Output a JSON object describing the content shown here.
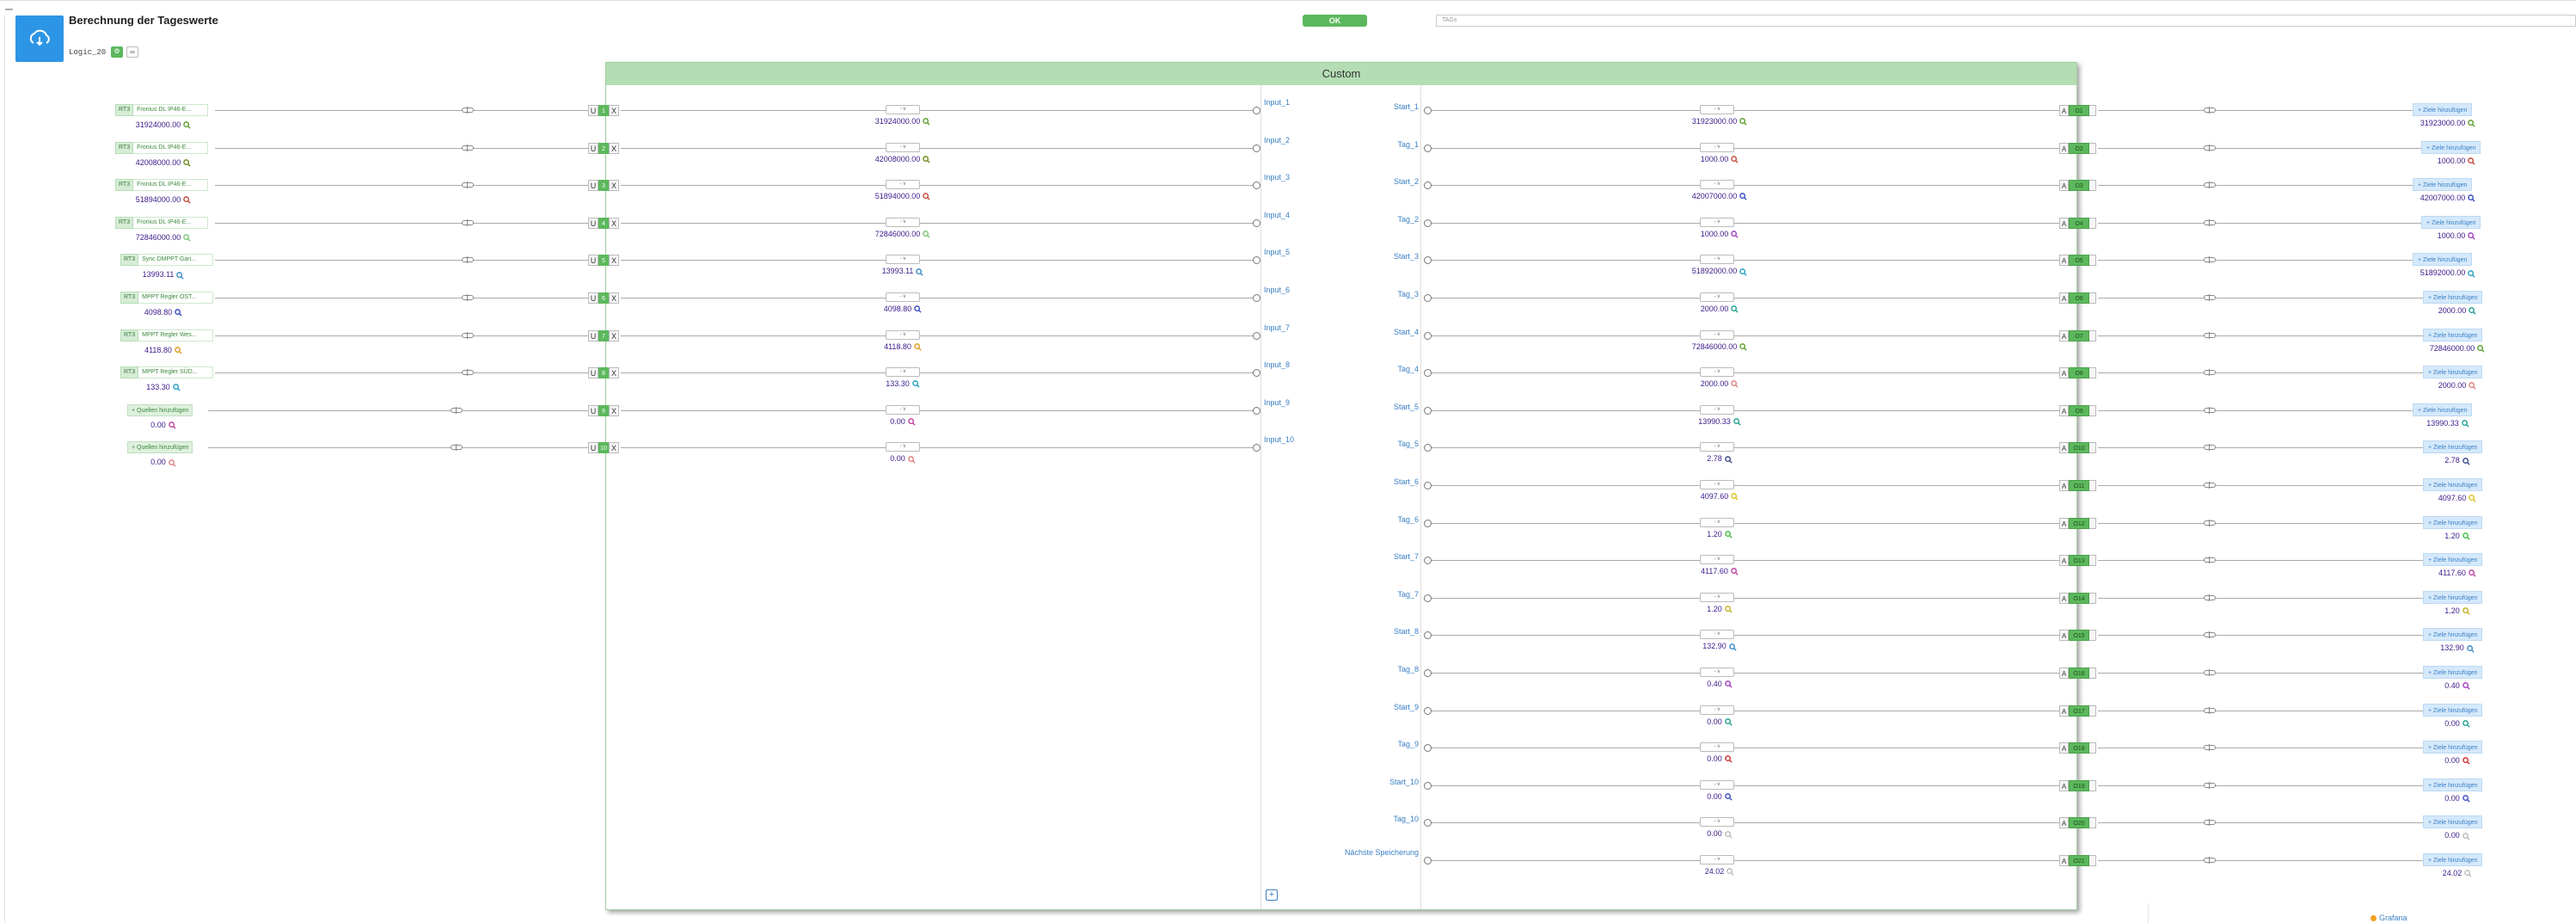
{
  "header": {
    "collapse_symbol": "–",
    "title": "Berechnung der Tageswerte",
    "logic_id": "Logic_20",
    "ok_label": "OK",
    "tags_placeholder": "TAGs",
    "app_icon": "cloud-sync-icon"
  },
  "panel": {
    "title": "Custom"
  },
  "inputs": [
    {
      "badge": "RT3",
      "source": "Fronius DL IP46-E...",
      "value": "31924000.00",
      "uix": "1",
      "label": "Input_1",
      "icon_color": "#5aa02c"
    },
    {
      "badge": "RT3",
      "source": "Fronius DL IP46-E...",
      "value": "42008000.00",
      "uix": "2",
      "label": "Input_2",
      "icon_color": "#6c8c1c"
    },
    {
      "badge": "RT3",
      "source": "Fronius DL IP46-E...",
      "value": "51894000.00",
      "uix": "3",
      "label": "Input_3",
      "icon_color": "#c04a3a"
    },
    {
      "badge": "RT3",
      "source": "Fronius DL IP46-E...",
      "value": "72846000.00",
      "uix": "4",
      "label": "Input_4",
      "icon_color": "#7ac47a"
    },
    {
      "badge": "RT3",
      "source": "Sync DMPPT Gari...",
      "value": "13993.11",
      "uix": "5",
      "label": "Input_5",
      "icon_color": "#3a8ac4"
    },
    {
      "badge": "RT3",
      "source": "MPPT Regler OST...",
      "value": "4098.80",
      "uix": "6",
      "label": "Input_6",
      "icon_color": "#3a4ac4"
    },
    {
      "badge": "RT3",
      "source": "MPPT Regler Wes...",
      "value": "4118.80",
      "uix": "7",
      "label": "Input_7",
      "icon_color": "#e09a20"
    },
    {
      "badge": "RT3",
      "source": "MPPT Regler SÜD...",
      "value": "133.30",
      "uix": "8",
      "label": "Input_8",
      "icon_color": "#20a0c0"
    },
    {
      "badge": "",
      "source": "+ Quellen hinzufügen",
      "value": "0.00",
      "uix": "9",
      "label": "Input_9",
      "icon_color": "#c040a0"
    },
    {
      "badge": "",
      "source": "+ Quellen hinzufügen",
      "value": "0.00",
      "uix": "10",
      "label": "Input_10",
      "icon_color": "#e08080"
    }
  ],
  "uix_letters": {
    "u": "U",
    "x": "X",
    "a": "A"
  },
  "dropdown_text": "- v",
  "outputs": [
    {
      "label": "Start_1",
      "value": "31923000.00",
      "out": "O1",
      "dest_value": "31923000.00",
      "icon_color": "#5aa02c"
    },
    {
      "label": "Tag_1",
      "value": "1000.00",
      "out": "O2",
      "dest_value": "1000.00",
      "icon_color": "#c04a3a"
    },
    {
      "label": "Start_2",
      "value": "42007000.00",
      "out": "O3",
      "dest_value": "42007000.00",
      "icon_color": "#3a4ac4"
    },
    {
      "label": "Tag_2",
      "value": "1000.00",
      "out": "O4",
      "dest_value": "1000.00",
      "icon_color": "#a040c0"
    },
    {
      "label": "Start_3",
      "value": "51892000.00",
      "out": "O5",
      "dest_value": "51892000.00",
      "icon_color": "#20a0c0"
    },
    {
      "label": "Tag_3",
      "value": "2000.00",
      "out": "O6",
      "dest_value": "2000.00",
      "icon_color": "#20a090"
    },
    {
      "label": "Start_4",
      "value": "72846000.00",
      "out": "O7",
      "dest_value": "72846000.00",
      "icon_color": "#5aa02c"
    },
    {
      "label": "Tag_4",
      "value": "2000.00",
      "out": "O8",
      "dest_value": "2000.00",
      "icon_color": "#e08080"
    },
    {
      "label": "Start_5",
      "value": "13990.33",
      "out": "O9",
      "dest_value": "13990.33",
      "icon_color": "#20a090"
    },
    {
      "label": "Tag_5",
      "value": "2.78",
      "out": "O10",
      "dest_value": "2.78",
      "icon_color": "#3a4a8a"
    },
    {
      "label": "Start_6",
      "value": "4097.60",
      "out": "O11",
      "dest_value": "4097.60",
      "icon_color": "#e0c020"
    },
    {
      "label": "Tag_6",
      "value": "1.20",
      "out": "O12",
      "dest_value": "1.20",
      "icon_color": "#40c040"
    },
    {
      "label": "Start_7",
      "value": "4117.60",
      "out": "O13",
      "dest_value": "4117.60",
      "icon_color": "#c040a0"
    },
    {
      "label": "Tag_7",
      "value": "1.20",
      "out": "O14",
      "dest_value": "1.20",
      "icon_color": "#c0b020"
    },
    {
      "label": "Start_8",
      "value": "132.90",
      "out": "O15",
      "dest_value": "132.90",
      "icon_color": "#3a8ac4"
    },
    {
      "label": "Tag_8",
      "value": "0.40",
      "out": "O16",
      "dest_value": "0.40",
      "icon_color": "#a040c0"
    },
    {
      "label": "Start_9",
      "value": "0.00",
      "out": "O17",
      "dest_value": "0.00",
      "icon_color": "#20a090"
    },
    {
      "label": "Tag_9",
      "value": "0.00",
      "out": "O18",
      "dest_value": "0.00",
      "icon_color": "#d03030"
    },
    {
      "label": "Start_10",
      "value": "0.00",
      "out": "O19",
      "dest_value": "0.00",
      "icon_color": "#3a4ac4"
    },
    {
      "label": "Tag_10",
      "value": "0.00",
      "out": "O20",
      "dest_value": "0.00",
      "icon_color": "#bbbbbb"
    },
    {
      "label": "Nächste Speicherung",
      "value": "24.02",
      "out": "O21",
      "dest_value": "24.02",
      "icon_color": "#bbbbbb"
    }
  ],
  "dest_label": "+ Ziele hinzufügen",
  "add_output_symbol": "+",
  "footer": {
    "grafana_label": "Grafana"
  }
}
